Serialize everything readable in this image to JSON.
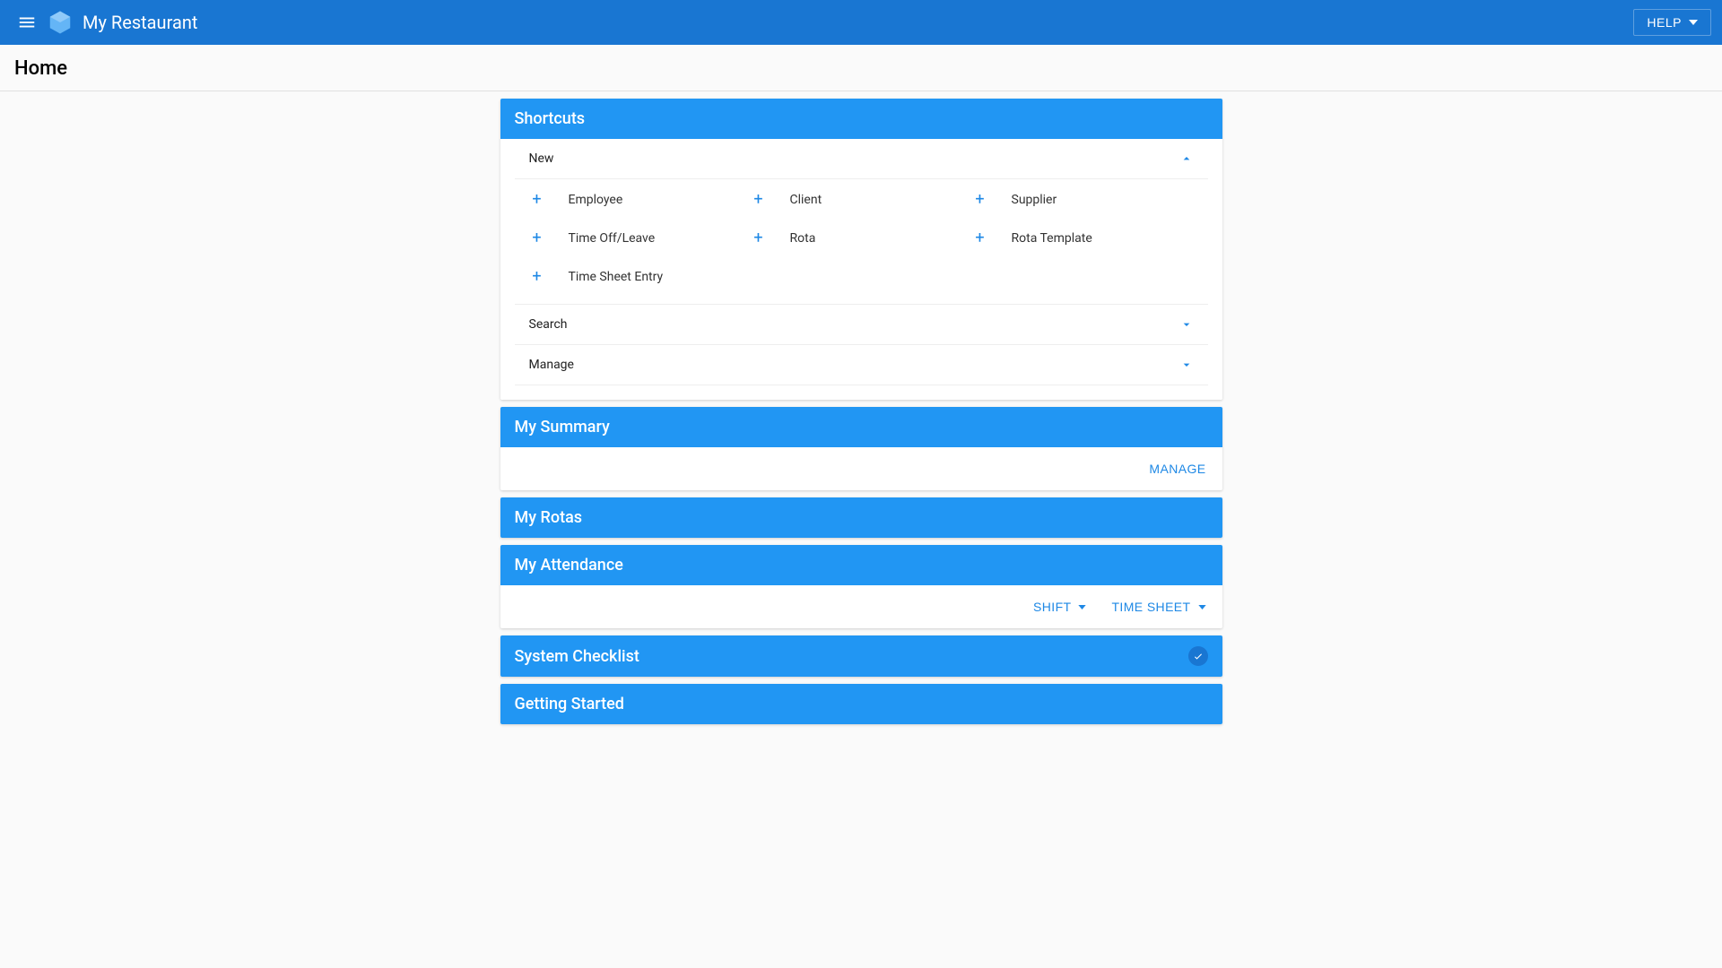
{
  "app": {
    "title": "My Restaurant",
    "help_label": "HELP"
  },
  "page": {
    "title": "Home"
  },
  "cards": {
    "shortcuts": {
      "title": "Shortcuts",
      "sections": {
        "new": {
          "label": "New"
        },
        "search": {
          "label": "Search"
        },
        "manage": {
          "label": "Manage"
        }
      },
      "new_items": [
        {
          "label": "Employee"
        },
        {
          "label": "Client"
        },
        {
          "label": "Supplier"
        },
        {
          "label": "Time Off/Leave"
        },
        {
          "label": "Rota"
        },
        {
          "label": "Rota Template"
        },
        {
          "label": "Time Sheet Entry"
        }
      ]
    },
    "my_summary": {
      "title": "My Summary",
      "manage_label": "MANAGE"
    },
    "my_rotas": {
      "title": "My Rotas"
    },
    "my_attendance": {
      "title": "My Attendance",
      "shift_label": "SHIFT",
      "timesheet_label": "TIME SHEET"
    },
    "system_checklist": {
      "title": "System Checklist"
    },
    "getting_started": {
      "title": "Getting Started"
    }
  }
}
